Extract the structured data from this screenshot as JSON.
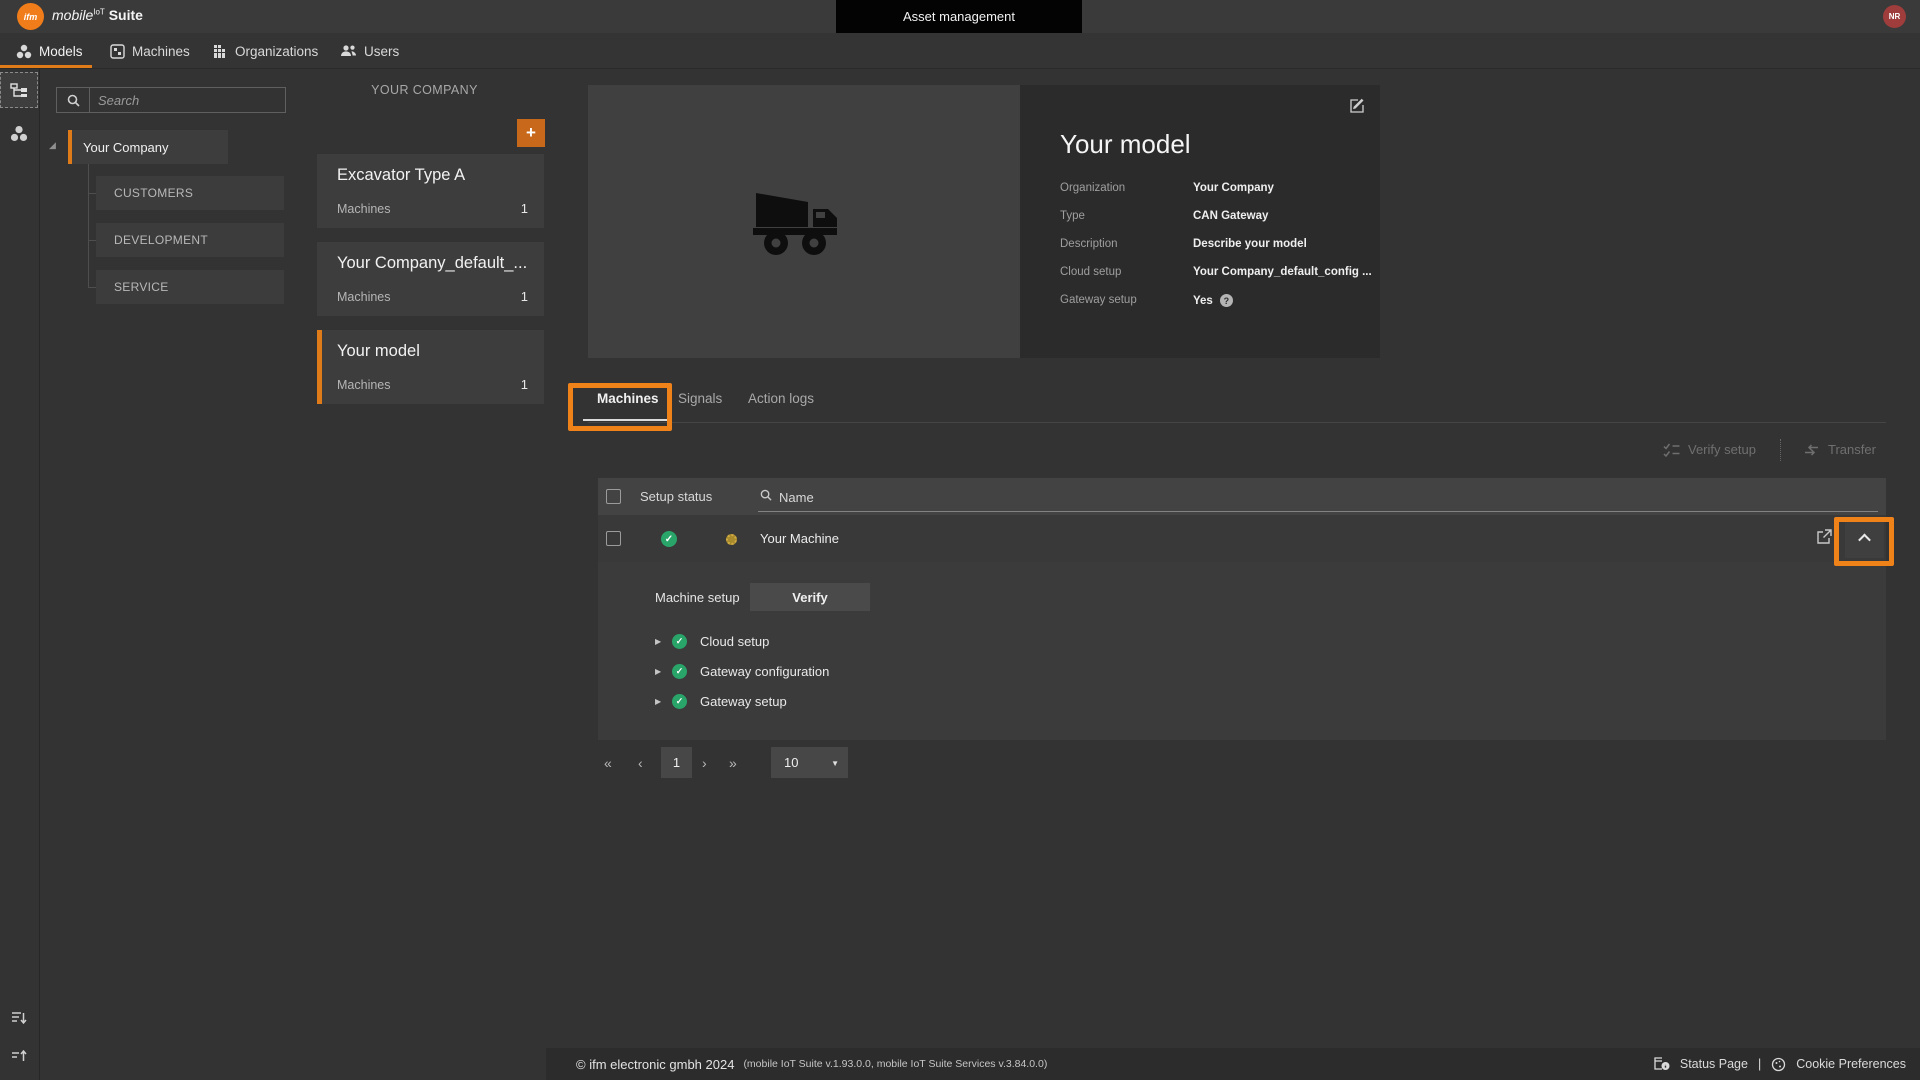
{
  "colors": {
    "accent_orange": "#e07b1a",
    "annotation_orange": "#ef831a",
    "add_button_orange": "#c8681a",
    "success_green": "#2aa56a",
    "pending_yellow": "#a98b2d",
    "avatar_red": "#9e3d3b",
    "background": "#333333"
  },
  "topbar": {
    "logo_text": "ifm",
    "brand_italic": "mobile",
    "brand_sup": "IoT",
    "brand_bold": "Suite",
    "page_title": "Asset management",
    "avatar_initials": "NR"
  },
  "nav": {
    "items": [
      {
        "label": "Models",
        "active": true
      },
      {
        "label": "Machines",
        "active": false
      },
      {
        "label": "Organizations",
        "active": false
      },
      {
        "label": "Users",
        "active": false
      }
    ]
  },
  "tree_panel": {
    "search_placeholder": "Search",
    "root_label": "Your Company",
    "children": [
      {
        "label": "CUSTOMERS"
      },
      {
        "label": "DEVELOPMENT"
      },
      {
        "label": "SERVICE"
      }
    ]
  },
  "models_panel": {
    "header": "YOUR COMPANY",
    "add_button": "+",
    "cards": [
      {
        "title": "Excavator Type A",
        "stat_label": "Machines",
        "stat_value": "1",
        "selected": false
      },
      {
        "title": "Your Company_default_...",
        "stat_label": "Machines",
        "stat_value": "1",
        "selected": false
      },
      {
        "title": "Your model",
        "stat_label": "Machines",
        "stat_value": "1",
        "selected": true
      }
    ]
  },
  "detail": {
    "title": "Your model",
    "fields": [
      {
        "label": "Organization",
        "value": "Your Company"
      },
      {
        "label": "Type",
        "value": "CAN Gateway"
      },
      {
        "label": "Description",
        "value": "Describe your model"
      },
      {
        "label": "Cloud setup",
        "value": "Your Company_default_config ..."
      },
      {
        "label": "Gateway setup",
        "value": "Yes"
      }
    ],
    "gateway_help": "?"
  },
  "tabs": [
    {
      "label": "Machines",
      "active": true
    },
    {
      "label": "Signals",
      "active": false
    },
    {
      "label": "Action logs",
      "active": false
    }
  ],
  "toolbar": {
    "verify_setup": "Verify setup",
    "transfer": "Transfer"
  },
  "table": {
    "setup_status_header": "Setup status",
    "name_filter_placeholder": "Name",
    "row": {
      "name": "Your Machine"
    }
  },
  "machine_setup": {
    "label": "Machine setup",
    "verify_button": "Verify",
    "checks": [
      {
        "label": "Cloud setup"
      },
      {
        "label": "Gateway configuration"
      },
      {
        "label": "Gateway setup"
      }
    ]
  },
  "pagination": {
    "first": "«",
    "prev": "‹",
    "page": "1",
    "next": "›",
    "last": "»",
    "page_size": "10",
    "caret": "▼"
  },
  "footer": {
    "copyright": "© ifm electronic gmbh 2024",
    "versions": "(mobile IoT Suite v.1.93.0.0, mobile IoT Suite Services v.3.84.0.0)",
    "status_page": "Status Page",
    "separator": "|",
    "cookie_preferences": "Cookie Preferences"
  }
}
